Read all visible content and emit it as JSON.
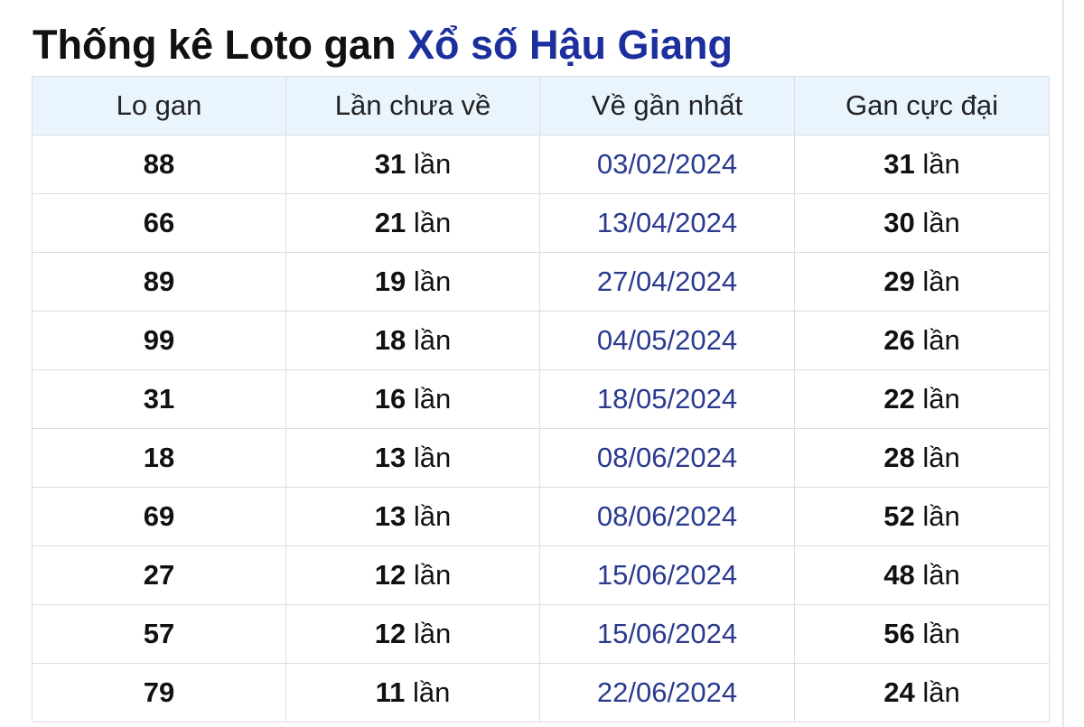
{
  "title": {
    "prefix": "Thống kê Loto gan ",
    "link": "Xổ số Hậu Giang"
  },
  "table": {
    "headers": [
      "Lo gan",
      "Lần chưa về",
      "Về gần nhất",
      "Gan cực đại"
    ],
    "unit": "lần",
    "rows": [
      {
        "lo": "88",
        "chua_ve": "31",
        "gan_nhat": "03/02/2024",
        "cuc_dai": "31"
      },
      {
        "lo": "66",
        "chua_ve": "21",
        "gan_nhat": "13/04/2024",
        "cuc_dai": "30"
      },
      {
        "lo": "89",
        "chua_ve": "19",
        "gan_nhat": "27/04/2024",
        "cuc_dai": "29"
      },
      {
        "lo": "99",
        "chua_ve": "18",
        "gan_nhat": "04/05/2024",
        "cuc_dai": "26"
      },
      {
        "lo": "31",
        "chua_ve": "16",
        "gan_nhat": "18/05/2024",
        "cuc_dai": "22"
      },
      {
        "lo": "18",
        "chua_ve": "13",
        "gan_nhat": "08/06/2024",
        "cuc_dai": "28"
      },
      {
        "lo": "69",
        "chua_ve": "13",
        "gan_nhat": "08/06/2024",
        "cuc_dai": "52"
      },
      {
        "lo": "27",
        "chua_ve": "12",
        "gan_nhat": "15/06/2024",
        "cuc_dai": "48"
      },
      {
        "lo": "57",
        "chua_ve": "12",
        "gan_nhat": "15/06/2024",
        "cuc_dai": "56"
      },
      {
        "lo": "79",
        "chua_ve": "11",
        "gan_nhat": "22/06/2024",
        "cuc_dai": "24"
      }
    ]
  },
  "colors": {
    "title_link": "#1c2f9c",
    "date_text": "#2b3a8f",
    "header_bg": "#eaf4fd",
    "border": "#d9dde6"
  }
}
